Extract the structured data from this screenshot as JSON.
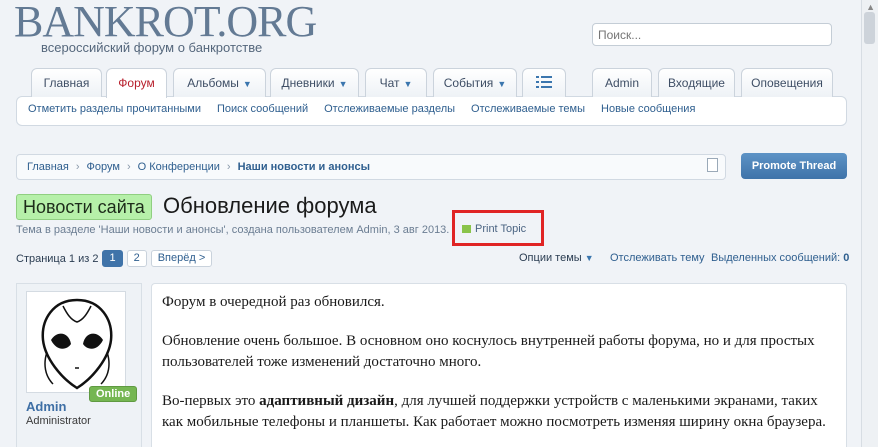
{
  "header": {
    "logo_main": "BANKROT.ORG",
    "logo_sub": "всероссийский форум о банкротстве",
    "search_placeholder": "Поиск..."
  },
  "tabs": [
    {
      "label": "Главная",
      "dropdown": false,
      "active": false
    },
    {
      "label": "Форум",
      "dropdown": false,
      "active": true
    },
    {
      "label": "Альбомы",
      "dropdown": true,
      "active": false
    },
    {
      "label": "Дневники",
      "dropdown": true,
      "active": false
    },
    {
      "label": "Чат",
      "dropdown": true,
      "active": false
    },
    {
      "label": "События",
      "dropdown": true,
      "active": false
    },
    {
      "label": "",
      "dropdown": false,
      "active": false,
      "icon": "menu-icon"
    },
    {
      "label": "Admin",
      "dropdown": false,
      "active": false
    },
    {
      "label": "Входящие",
      "dropdown": false,
      "active": false
    },
    {
      "label": "Оповещения",
      "dropdown": false,
      "active": false
    }
  ],
  "subnav": [
    "Отметить разделы прочитанными",
    "Поиск сообщений",
    "Отслеживаемые разделы",
    "Отслеживаемые темы",
    "Новые сообщения"
  ],
  "breadcrumb": [
    "Главная",
    "Форум",
    "О Конференции",
    "Наши новости и анонсы"
  ],
  "promote_label": "Promote Thread",
  "thread": {
    "prefix": "Новости сайта",
    "title": "Обновление форума",
    "meta": "Тема в разделе 'Наши новости и анонсы', создана пользователем Admin, 3 авг 2013.",
    "print_label": "Print Topic"
  },
  "pager": {
    "label": "Страница 1 из 2",
    "pages": [
      "1",
      "2"
    ],
    "current": "1",
    "next_label": "Вперёд >",
    "options_label": "Опции темы",
    "watch_label": "Отслеживать тему",
    "selected_label": "Выделенных сообщений:",
    "selected_count": "0"
  },
  "post": {
    "status": "Online",
    "username": "Admin",
    "role": "Administrator",
    "para1": "Форум в очередной раз обновился.",
    "para2": "Обновление очень большое. В основном оно коснулось внутренней работы форума, но и для простых пользователей тоже изменений достаточно много.",
    "para3_pre": "Во-первых это ",
    "para3_bold": "адаптивный дизайн",
    "para3_post": ", для лучшей поддержки устройств с маленькими экранами, таких как мобильные телефоны и планшеты. Как работает можно посмотреть изменяя ширину окна браузера."
  },
  "colors": {
    "accent": "#3f73a9",
    "active_tab": "#b8202d",
    "prefix_bg": "#b6f0a9",
    "online_badge": "#75b652",
    "highlight_box": "#e02424"
  }
}
